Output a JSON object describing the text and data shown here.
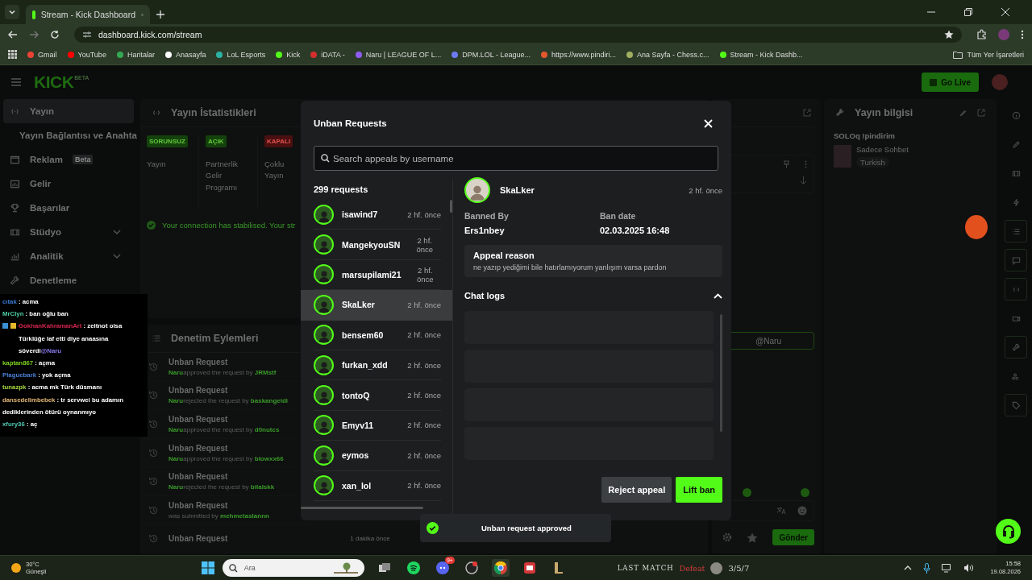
{
  "browser": {
    "tabs": [
      {
        "title": "Stream - Kick Dashboard",
        "selected": true
      }
    ],
    "address": "dashboard.kick.com/stream",
    "bookmarks": [
      "Gmail",
      "YouTube",
      "Haritalar",
      "Anasayfa",
      "LoL Esports",
      "Kick",
      "iDATA -",
      "Naru | LEAGUE OF L...",
      "DPM.LOL - League...",
      "https://www.pindiri...",
      "Ana Sayfa - Chess.c...",
      "Stream - Kick Dashb..."
    ],
    "all_bookmarks": "Tüm Yer İşaretleri"
  },
  "header": {
    "logo": "KICK",
    "logo_badge": "BETA",
    "go_live": "Go Live"
  },
  "sidebar": {
    "items": [
      {
        "label": "Yayın",
        "selected": true,
        "expandable": false
      },
      {
        "label": "Yayın Bağlantısı ve Anahta",
        "selected": false,
        "expandable": false
      },
      {
        "label": "Reklam",
        "badge": "Beta",
        "selected": false,
        "expandable": false
      },
      {
        "label": "Gelir",
        "selected": false,
        "expandable": false
      },
      {
        "label": "Başarılar",
        "selected": false,
        "expandable": false
      },
      {
        "label": "Stüdyo",
        "selected": false,
        "expandable": true
      },
      {
        "label": "Analitik",
        "selected": false,
        "expandable": true
      },
      {
        "label": "Denetleme",
        "selected": false,
        "expandable": false
      }
    ]
  },
  "stats_panel": {
    "title": "Yayın İstatistikleri",
    "stats": [
      {
        "status": "SORUNSUZ",
        "label": "Yayın",
        "kind": "ok"
      },
      {
        "status": "AÇIK",
        "label": "Partnerlik Gelir Programı",
        "kind": "ok"
      },
      {
        "status": "KAPALI",
        "label": "Çoklu Yayın",
        "kind": "off"
      }
    ],
    "message": "Your connection has stabilised. Your str"
  },
  "moderation_panel": {
    "title": "Denetim Eylemleri",
    "actions": [
      {
        "title": "Unban Request",
        "actor": "Naru",
        "action": "approved the request by",
        "target": "JRMstf"
      },
      {
        "title": "Unban Request",
        "actor": "Naru",
        "action": "rejected the request by",
        "target": "baskangeldi"
      },
      {
        "title": "Unban Request",
        "actor": "Naru",
        "action": "approved the request by",
        "target": "d0nutcs"
      },
      {
        "title": "Unban Request",
        "actor": "Naru",
        "action": "approved the request by",
        "target": "blowxx66"
      },
      {
        "title": "Unban Request",
        "actor": "Naru",
        "action": "rejected the request by",
        "target": "bilalskk"
      },
      {
        "title": "Unban Request",
        "action": "was submitted by",
        "target": "mehmetaslannn"
      },
      {
        "title": "Unban Request",
        "time": "1 dakika önce"
      }
    ]
  },
  "chat_panel": {
    "reply_to": "@Naru",
    "send": "Gönder"
  },
  "stream_info": {
    "title": "Yayın bilgisi",
    "stream_title": "SOLOq !pindirim",
    "category": "Sadece Sohbet",
    "tag": "Turkish"
  },
  "right_rail": [
    {
      "open": false
    },
    {
      "open": false
    },
    {
      "open": false
    },
    {
      "open": false
    },
    {
      "open": true
    },
    {
      "open": true
    },
    {
      "open": true
    },
    {
      "open": false
    },
    {
      "open": true
    },
    {
      "open": false
    },
    {
      "open": true
    }
  ],
  "chat_overlay": {
    "messages": [
      {
        "user": "cıtak",
        "color": "#3a7bd5",
        "text": ": acma",
        "badges": false
      },
      {
        "user": "MrClyn",
        "color": "#4fd1a5",
        "text": ": ban oğlu ban",
        "badges": false
      },
      {
        "user": "GokhanKahramanArt",
        "color": "#d4264f",
        "text": ": zeitnot olsa Türklüğe laf etti diye anaasına söverdi",
        "mention": "@Naru",
        "badges": true
      },
      {
        "user": "kaptan867",
        "color": "#7ed321",
        "text": ": açma",
        "badges": false
      },
      {
        "user": "Plaguebark",
        "color": "#4a7fd6",
        "text": ": yok açma",
        "badges": false
      },
      {
        "user": "tunazpk",
        "color": "#a5d63f",
        "text": ": acma mk Türk düsmanı",
        "badges": false
      },
      {
        "user": "dansedelimbebek",
        "color": "#e3b877",
        "text": ": tr servwei bu adamın dediklerinden ötürü oynanmıyo",
        "badges": false
      },
      {
        "user": "xfury36",
        "color": "#4fc9b5",
        "text": ": aç",
        "badges": false
      }
    ]
  },
  "modal": {
    "title": "Unban Requests",
    "search_placeholder": "Search appeals by username",
    "count": "299 requests",
    "requests": [
      {
        "name": "isawind7",
        "time": "2 hf. önce",
        "selected": false
      },
      {
        "name": "MangekyouSN",
        "time": "2 hf. önce",
        "selected": false
      },
      {
        "name": "marsupilami21",
        "time": "2 hf. önce",
        "selected": false
      },
      {
        "name": "SkaLker",
        "time": "2 hf. önce",
        "selected": true
      },
      {
        "name": "bensem60",
        "time": "2 hf. önce",
        "selected": false
      },
      {
        "name": "furkan_xdd",
        "time": "2 hf. önce",
        "selected": false
      },
      {
        "name": "tontoQ",
        "time": "2 hf. önce",
        "selected": false
      },
      {
        "name": "Emyv11",
        "time": "2 hf. önce",
        "selected": false
      },
      {
        "name": "eymos",
        "time": "2 hf. önce",
        "selected": false
      },
      {
        "name": "xan_lol",
        "time": "2 hf. önce",
        "selected": false
      }
    ],
    "detail": {
      "name": "SkaLker",
      "time": "2 hf. önce",
      "banned_by_label": "Banned By",
      "banned_by": "Ers1nbey",
      "ban_date_label": "Ban date",
      "ban_date": "02.03.2025 16:48",
      "appeal_label": "Appeal reason",
      "appeal_text": "ne yazıp yediğimi bile hatırlamıyorum yanlışım varsa pardon",
      "chat_logs_label": "Chat logs",
      "chat_logs_expanded": true
    },
    "reject": "Reject appeal",
    "lift": "Lift ban"
  },
  "toast": "Unban request approved",
  "taskbar": {
    "temperature": "30°C",
    "weather": "Güneşli",
    "search_placeholder": "Ara",
    "discord_badge": "9+",
    "last_match_label": "LAST MATCH",
    "last_match_result": "Defeat",
    "last_match_kda": "3/5/7",
    "time": "15:58",
    "date": "19.08.2026"
  }
}
